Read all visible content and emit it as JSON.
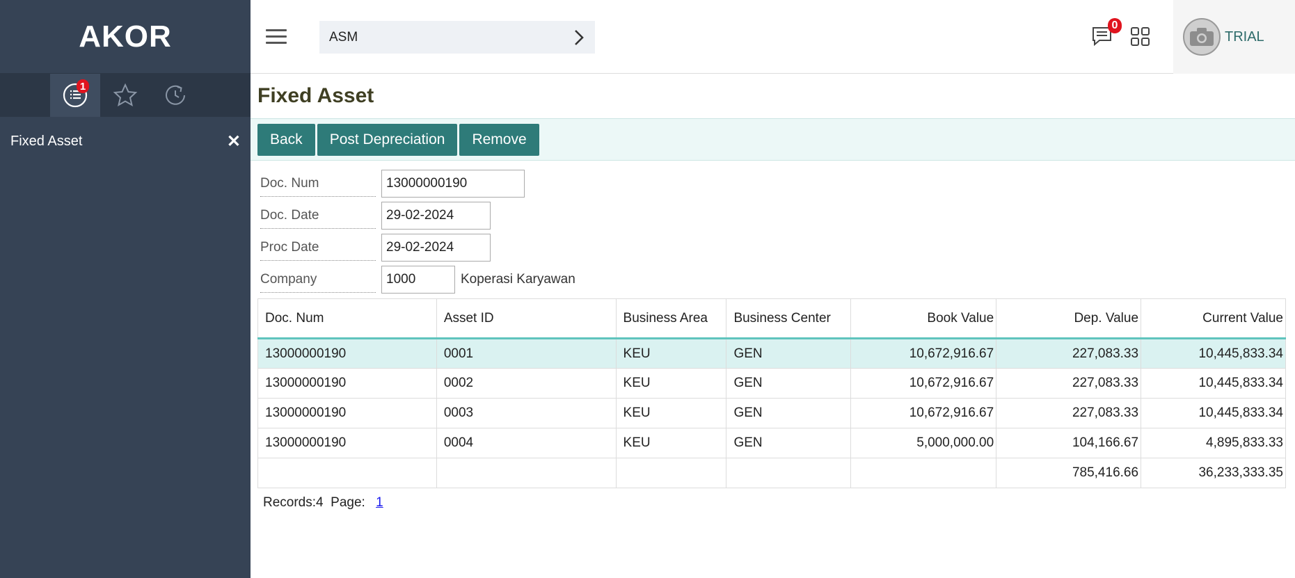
{
  "app": {
    "brand": "AKOR"
  },
  "sidebar": {
    "tabs": [
      {
        "name": "list-icon",
        "badge": "1"
      },
      {
        "name": "star-icon"
      },
      {
        "name": "history-icon"
      }
    ],
    "items": [
      {
        "label": "Fixed Asset"
      }
    ]
  },
  "topbar": {
    "module": "ASM",
    "message_count": "0",
    "user": "TRIAL"
  },
  "page": {
    "title": "Fixed Asset",
    "toolbar": {
      "back": "Back",
      "post": "Post Depreciation",
      "remove": "Remove"
    }
  },
  "form": {
    "doc_num": {
      "label": "Doc. Num",
      "value": "13000000190"
    },
    "doc_date": {
      "label": "Doc. Date",
      "value": "29-02-2024"
    },
    "proc_date": {
      "label": "Proc Date",
      "value": "29-02-2024"
    },
    "company": {
      "label": "Company",
      "value": "1000",
      "name": "Koperasi Karyawan"
    }
  },
  "table": {
    "headers": [
      "Doc. Num",
      "Asset ID",
      "Business Area",
      "Business Center",
      "Book Value",
      "Dep. Value",
      "Current Value"
    ],
    "rows": [
      [
        "13000000190",
        "0001",
        "KEU",
        "GEN",
        "10,672,916.67",
        "227,083.33",
        "10,445,833.34"
      ],
      [
        "13000000190",
        "0002",
        "KEU",
        "GEN",
        "10,672,916.67",
        "227,083.33",
        "10,445,833.34"
      ],
      [
        "13000000190",
        "0003",
        "KEU",
        "GEN",
        "10,672,916.67",
        "227,083.33",
        "10,445,833.34"
      ],
      [
        "13000000190",
        "0004",
        "KEU",
        "GEN",
        "5,000,000.00",
        "104,166.67",
        "4,895,833.33"
      ]
    ],
    "totals": {
      "dep_value": "785,416.66",
      "current_value": "36,233,333.35"
    }
  },
  "pager": {
    "records_label": "Records:4",
    "page_label": "Page:",
    "page": "1"
  },
  "colors": {
    "accent": "#2e7b79",
    "sidebar": "#364355",
    "badge": "#e0141e"
  }
}
